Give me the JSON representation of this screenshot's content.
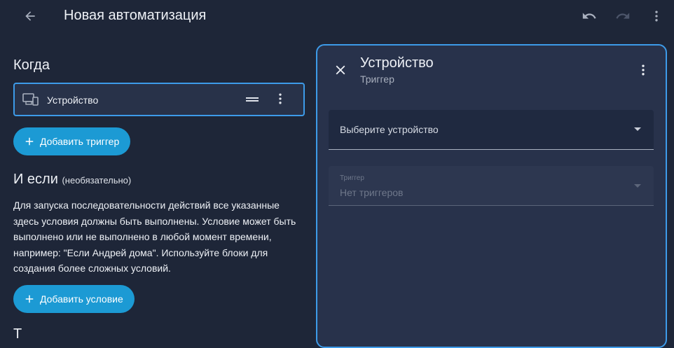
{
  "header": {
    "title": "Новая автоматизация",
    "icons": {
      "back": "arrow-back-icon",
      "undo": "undo-icon",
      "redo": "redo-icon",
      "menu": "more-vertical-icon"
    }
  },
  "when": {
    "heading": "Когда",
    "trigger": {
      "label": "Устройство",
      "icon": "devices-icon"
    },
    "add_button": "Добавить триггер"
  },
  "conditions": {
    "heading": "И если",
    "optional": "(необязательно)",
    "description": "Для запуска последовательности действий все указанные здесь условия должны быть выполнены. Условие может быть выполнено или не выполнено в любой момент времени, например: \"Если Андрей дома\". Используйте блоки для создания более сложных условий.",
    "add_button": "Добавить условие"
  },
  "actions": {
    "heading": "Т"
  },
  "panel": {
    "title": "Устройство",
    "subtitle": "Триггер",
    "device_select": {
      "placeholder": "Выберите устройство"
    },
    "trigger_select": {
      "label": "Триггер",
      "value": "Нет триггеров"
    }
  },
  "colors": {
    "background": "#1e2638",
    "card": "#283249",
    "accent_border": "#3d9be9",
    "button": "#1c9ad4"
  }
}
